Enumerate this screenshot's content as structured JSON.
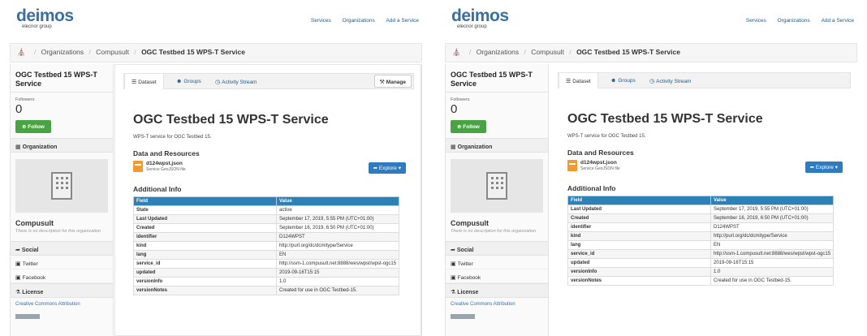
{
  "logo": {
    "mark": "deimos",
    "sub": "elecnor group"
  },
  "nav": {
    "services": "Services",
    "organizations": "Organizations",
    "add_service": "Add a Service"
  },
  "breadcrumb": {
    "organizations": "Organizations",
    "org": "Compusult",
    "current": "OGC Testbed 15 WPS-T Service"
  },
  "sidebar": {
    "title": "OGC Testbed 15 WPS-T Service",
    "followers_label": "Followers",
    "followers_count": "0",
    "follow_button": "Follow",
    "organization_heading": "Organization",
    "org_name": "Compusult",
    "org_desc": "There is no description for this organization",
    "social_heading": "Social",
    "twitter": "Twitter",
    "facebook": "Facebook",
    "license_heading": "License",
    "license_name": "Creative Commons Attribution"
  },
  "tabs": {
    "dataset": "Dataset",
    "groups": "Groups",
    "activity": "Activity Stream"
  },
  "manage_button": "Manage",
  "dataset": {
    "title": "OGC Testbed 15 WPS-T Service",
    "description": "WPS-T service for OGC Testbed 15.",
    "resources_heading": "Data and Resources",
    "resource_name": "d124wpst.json",
    "resource_desc": "Service GeoJSON file",
    "explore_button": "Explore",
    "additional_heading": "Additional Info"
  },
  "info_headers": {
    "field": "Field",
    "value": "Value"
  },
  "info_rows_a": [
    {
      "k": "State",
      "v": "active"
    },
    {
      "k": "Last Updated",
      "v": "September 17, 2019, 5:55 PM (UTC+01:00)"
    },
    {
      "k": "Created",
      "v": "September 16, 2019, 6:50 PM (UTC+01:00)"
    },
    {
      "k": "identifier",
      "v": "D124WPST"
    },
    {
      "k": "kind",
      "v": "http://purl.org/dc/dcmitype/Service"
    },
    {
      "k": "lang",
      "v": "EN"
    },
    {
      "k": "service_id",
      "v": "http://ssm-1.compusult.net:8888/wes/wpst/wpst-ogc15"
    },
    {
      "k": "updated",
      "v": "2019-09-16T15:15"
    },
    {
      "k": "versionInfo",
      "v": "1.0"
    },
    {
      "k": "versionNotes",
      "v": "Created for use in OGC Testbed-15."
    }
  ],
  "info_rows_b": [
    {
      "k": "Last Updated",
      "v": "September 17, 2019, 5:55 PM (UTC+01:00)"
    },
    {
      "k": "Created",
      "v": "September 16, 2019, 6:50 PM (UTC+01:00)"
    },
    {
      "k": "identifier",
      "v": "D124WPST"
    },
    {
      "k": "kind",
      "v": "http://purl.org/dc/dcmitype/Service"
    },
    {
      "k": "lang",
      "v": "EN"
    },
    {
      "k": "service_id",
      "v": "http://ssm-1.compusult.net:8888/wes/wpst/wpst-ogc15"
    },
    {
      "k": "updated",
      "v": "2019-09-16T15:15"
    },
    {
      "k": "versionInfo",
      "v": "1.0"
    },
    {
      "k": "versionNotes",
      "v": "Created for use in OGC Testbed-15."
    }
  ]
}
